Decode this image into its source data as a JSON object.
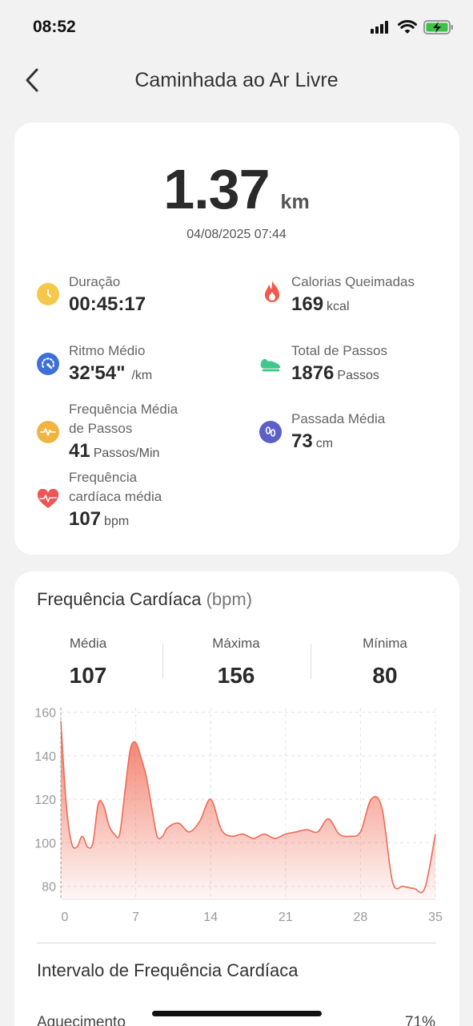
{
  "status": {
    "time": "08:52"
  },
  "header": {
    "title": "Caminhada ao Ar Livre"
  },
  "summary": {
    "distance_value": "1.37",
    "distance_unit": "km",
    "datetime": "04/08/2025 07:44",
    "stats": {
      "duration": {
        "label": "Duração",
        "value": "00:45:17",
        "icon": "clock-icon",
        "color": "#f5c84c"
      },
      "calories": {
        "label": "Calorias Queimadas",
        "value": "169",
        "unit": "kcal",
        "icon": "flame-icon",
        "color": "#f05a4a"
      },
      "pace": {
        "label": "Ritmo Médio",
        "value": "32'54\"",
        "unit": "/km",
        "icon": "speedometer-icon",
        "color": "#3f6fd8"
      },
      "steps": {
        "label": "Total de Passos",
        "value": "1876",
        "unit": "Passos",
        "icon": "shoe-icon",
        "color": "#3ec98a"
      },
      "cadence": {
        "label_line1": "Frequência Média",
        "label_line2": "de Passos",
        "value": "41",
        "unit": "Passos/Min",
        "icon": "cadence-icon",
        "color": "#f2b441"
      },
      "stride": {
        "label": "Passada Média",
        "value": "73",
        "unit": "cm",
        "icon": "footprints-icon",
        "color": "#5b5fc7"
      },
      "heart_rate": {
        "label_line1": "Frequência",
        "label_line2": "cardíaca média",
        "value": "107",
        "unit": "bpm",
        "icon": "heart-icon",
        "color": "#ee5555"
      }
    }
  },
  "heart_card": {
    "title": "Frequência Cardíaca",
    "title_unit": "(bpm)",
    "avg_label": "Média",
    "avg_value": "107",
    "max_label": "Máxima",
    "max_value": "156",
    "min_label": "Mínima",
    "min_value": "80",
    "range_title": "Intervalo de Frequência Cardíaca",
    "range_first_label": "Aquecimento",
    "range_first_pct": "71%"
  },
  "chart_data": {
    "type": "area",
    "color": "#f06a55",
    "x": [
      0,
      0.5,
      1,
      1.5,
      2,
      2.5,
      3,
      3.5,
      4,
      4.5,
      5,
      5.5,
      6,
      6.5,
      7,
      7.5,
      8,
      8.5,
      9,
      9.5,
      10,
      11,
      12,
      13,
      14,
      15,
      16,
      17,
      18,
      19,
      20,
      21,
      22,
      23,
      24,
      25,
      26,
      27,
      28,
      29,
      30,
      31,
      32,
      33,
      34,
      35
    ],
    "values": [
      156,
      118,
      100,
      98,
      103,
      98,
      100,
      118,
      117,
      108,
      104,
      104,
      124,
      143,
      146,
      139,
      130,
      116,
      103,
      103,
      107,
      109,
      105,
      110,
      120,
      106,
      103,
      104,
      102,
      104,
      102,
      104,
      105,
      106,
      105,
      111,
      104,
      103,
      105,
      120,
      116,
      82,
      80,
      79,
      79,
      104
    ],
    "xticks": [
      0,
      7,
      14,
      21,
      28,
      35
    ],
    "yticks": [
      80,
      100,
      120,
      140,
      160
    ],
    "xlim": [
      0,
      35
    ],
    "ylim": [
      74,
      162
    ],
    "grid": true,
    "title": "",
    "xlabel": "",
    "ylabel": ""
  }
}
